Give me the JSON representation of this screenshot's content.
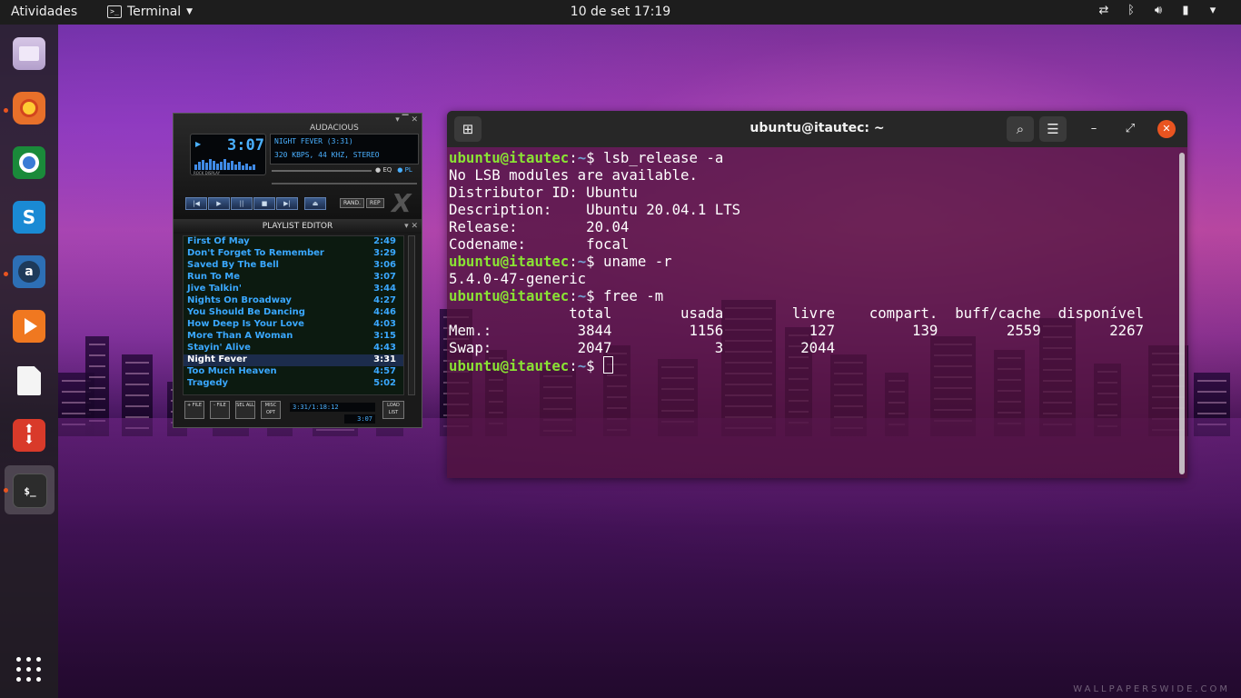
{
  "topbar": {
    "activities": "Atividades",
    "app_name": "Terminal",
    "app_icon": "terminal-icon",
    "clock": "10 de set  17:19",
    "tray": [
      "network-icon",
      "bluetooth-icon",
      "volume-icon",
      "battery-icon",
      "power-menu-icon"
    ]
  },
  "dock": {
    "items": [
      "files-icon",
      "firefox-icon",
      "chrome-icon",
      "skype-icon",
      "amazon-icon",
      "audacious-icon",
      "libreoffice-icon",
      "updater-icon",
      "terminal-icon"
    ],
    "show_apps": "show-applications-icon"
  },
  "audacious": {
    "title": "AUDACIOUS",
    "time": "3:07",
    "song_info": "NIGHT FEVER (3:31)",
    "stream_info": "320 KBPS, 44 KHZ, STEREO",
    "vis_label": "ROCK DISPLAY",
    "eq_label": "EQ",
    "pl_label": "PL",
    "rand_label": "RAND.",
    "rep_label": "REP",
    "playlist": {
      "title": "PLAYLIST EDITOR",
      "items": [
        {
          "title": "First Of May",
          "duration": "2:49"
        },
        {
          "title": "Don't Forget To Remember",
          "duration": "3:29"
        },
        {
          "title": "Saved By The Bell",
          "duration": "3:06"
        },
        {
          "title": "Run To Me",
          "duration": "3:07"
        },
        {
          "title": "Jive Talkin'",
          "duration": "3:44"
        },
        {
          "title": "Nights On Broadway",
          "duration": "4:27"
        },
        {
          "title": "You Should Be Dancing",
          "duration": "4:46"
        },
        {
          "title": "How Deep Is Your Love",
          "duration": "4:03"
        },
        {
          "title": "More Than A Woman",
          "duration": "3:15"
        },
        {
          "title": "Stayin' Alive",
          "duration": "4:43"
        },
        {
          "title": "Night Fever",
          "duration": "3:31"
        },
        {
          "title": "Too Much Heaven",
          "duration": "4:57"
        },
        {
          "title": "Tragedy",
          "duration": "5:02"
        }
      ],
      "current_index": 10,
      "footer_buttons": [
        "+ FILE",
        "- FILE",
        "SEL ALL",
        "MISC OPT"
      ],
      "load_list": "LOAD LIST",
      "status": "3:31/1:18:12",
      "time": "3:07"
    }
  },
  "terminal": {
    "title": "ubuntu@itautec: ~",
    "user_host": "ubuntu@itautec",
    "path": "~",
    "lines": [
      {
        "kind": "prompt",
        "cmd": " lsb_release -a"
      },
      {
        "kind": "out",
        "text": "No LSB modules are available."
      },
      {
        "kind": "out",
        "text": "Distributor ID:\tUbuntu"
      },
      {
        "kind": "out",
        "text": "Description:\tUbuntu 20.04.1 LTS"
      },
      {
        "kind": "out",
        "text": "Release:\t20.04"
      },
      {
        "kind": "out",
        "text": "Codename:\tfocal"
      },
      {
        "kind": "prompt",
        "cmd": " uname -r"
      },
      {
        "kind": "out",
        "text": "5.4.0-47-generic"
      },
      {
        "kind": "prompt",
        "cmd": " free -m"
      },
      {
        "kind": "out",
        "text": "              total        usada        livre    compart.  buff/cache  disponível"
      },
      {
        "kind": "out",
        "text": "Mem.:          3844         1156          127         139        2559        2267"
      },
      {
        "kind": "out",
        "text": "Swap:          2047            3         2044"
      },
      {
        "kind": "prompt_cursor",
        "cmd": " "
      }
    ]
  },
  "watermark": "WALLPAPERSWIDE.COM"
}
